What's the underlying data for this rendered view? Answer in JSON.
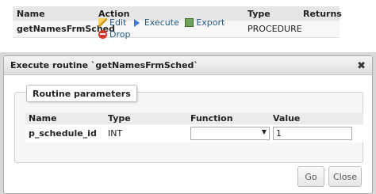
{
  "routines": {
    "headers": {
      "name": "Name",
      "action": "Action",
      "type": "Type",
      "returns": "Returns"
    },
    "row": {
      "name": "getNamesFrmSched",
      "actions": {
        "edit": "Edit",
        "execute": "Execute",
        "export": "Export",
        "drop": "Drop"
      },
      "type": "PROCEDURE",
      "returns": ""
    }
  },
  "dialog": {
    "title": "Execute routine `getNamesFrmSched`",
    "close_glyph": "✖",
    "legend": "Routine parameters",
    "param_headers": {
      "name": "Name",
      "type": "Type",
      "function": "Function",
      "value": "Value"
    },
    "param": {
      "name": "p_schedule_id",
      "type": "INT",
      "function": "",
      "value": "1"
    },
    "go_label": "Go",
    "close_label": "Close"
  }
}
